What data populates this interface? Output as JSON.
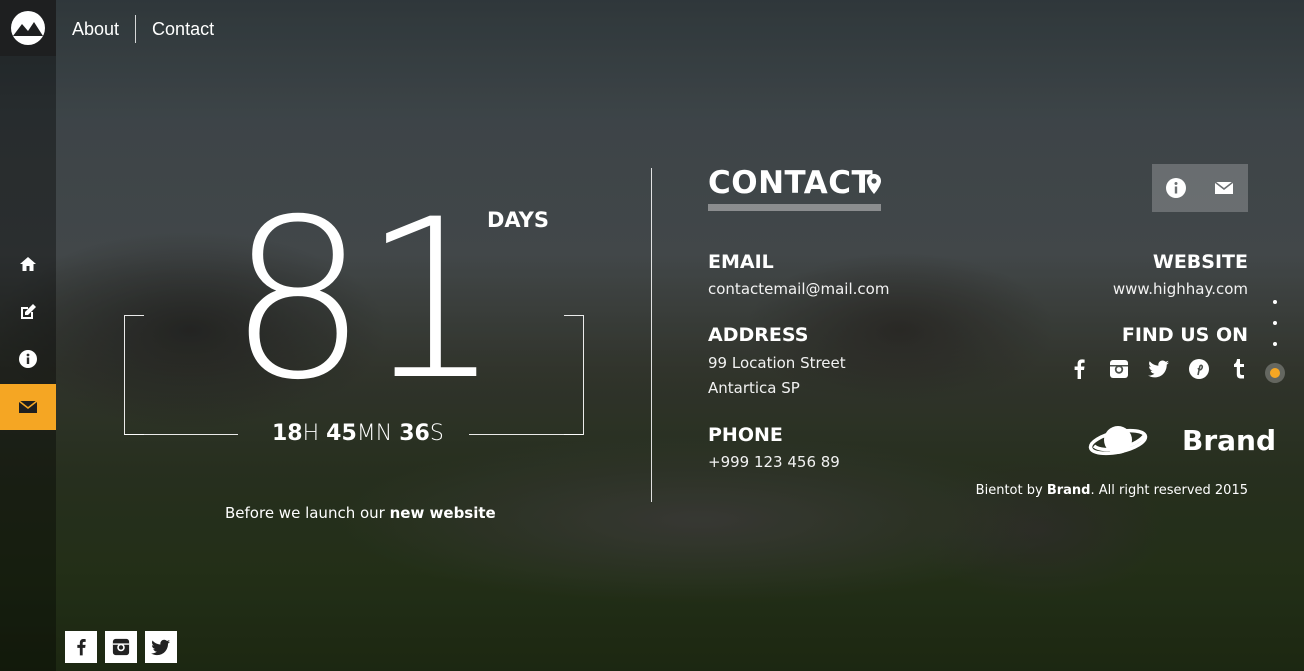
{
  "nav": {
    "about": "About",
    "contact": "Contact"
  },
  "sidebar": {
    "items": [
      {
        "icon": "home-icon"
      },
      {
        "icon": "edit-icon"
      },
      {
        "icon": "info-icon"
      },
      {
        "icon": "mail-icon",
        "active": true
      }
    ]
  },
  "countdown": {
    "days_value": "81",
    "days_label": "DAYS",
    "hours": "18",
    "hours_unit": "H",
    "minutes": "45",
    "minutes_unit": "MN",
    "seconds": "36",
    "seconds_unit": "S",
    "tagline_prefix": "Before we launch our",
    "tagline_bold": "new website"
  },
  "contact": {
    "title": "CONTACT",
    "email_label": "EMAIL",
    "email_value": "contactemail@mail.com",
    "address_label": "ADDRESS",
    "address_line1": "99 Location Street",
    "address_line2": "Antartica SP",
    "phone_label": "PHONE",
    "phone_value": "+999 123 456 89",
    "website_label": "WEBSITE",
    "website_value": "www.highhay.com",
    "find_us_label": "FIND US ON",
    "brand_name": "Brand",
    "footer_prefix": "Bientot by",
    "footer_brand": "Brand",
    "footer_suffix": ". All right reserved 2015"
  },
  "colors": {
    "accent": "#f5a623"
  }
}
